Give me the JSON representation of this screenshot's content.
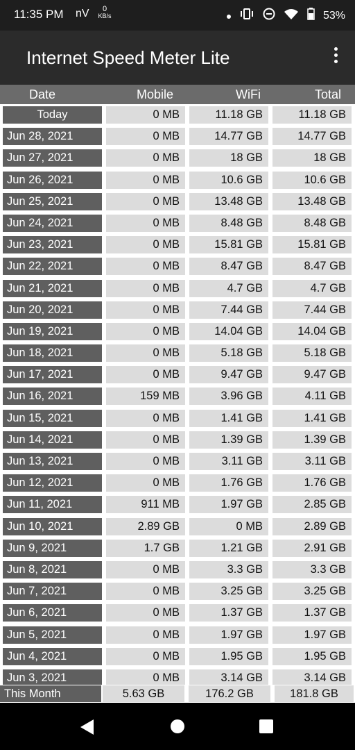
{
  "status": {
    "time": "11:35 PM",
    "nv": "nV",
    "speed_value": "0",
    "speed_unit": "KB/s",
    "battery": "53%"
  },
  "app": {
    "title": "Internet Speed Meter Lite"
  },
  "columns": {
    "date": "Date",
    "mobile": "Mobile",
    "wifi": "WiFi",
    "total": "Total"
  },
  "rows": [
    {
      "date": "Today",
      "mobile": "0 MB",
      "wifi": "11.18 GB",
      "total": "11.18 GB"
    },
    {
      "date": "Jun 28, 2021",
      "mobile": "0 MB",
      "wifi": "14.77 GB",
      "total": "14.77 GB"
    },
    {
      "date": "Jun 27, 2021",
      "mobile": "0 MB",
      "wifi": "18 GB",
      "total": "18 GB"
    },
    {
      "date": "Jun 26, 2021",
      "mobile": "0 MB",
      "wifi": "10.6 GB",
      "total": "10.6 GB"
    },
    {
      "date": "Jun 25, 2021",
      "mobile": "0 MB",
      "wifi": "13.48 GB",
      "total": "13.48 GB"
    },
    {
      "date": "Jun 24, 2021",
      "mobile": "0 MB",
      "wifi": "8.48 GB",
      "total": "8.48 GB"
    },
    {
      "date": "Jun 23, 2021",
      "mobile": "0 MB",
      "wifi": "15.81 GB",
      "total": "15.81 GB"
    },
    {
      "date": "Jun 22, 2021",
      "mobile": "0 MB",
      "wifi": "8.47 GB",
      "total": "8.47 GB"
    },
    {
      "date": "Jun 21, 2021",
      "mobile": "0 MB",
      "wifi": "4.7 GB",
      "total": "4.7 GB"
    },
    {
      "date": "Jun 20, 2021",
      "mobile": "0 MB",
      "wifi": "7.44 GB",
      "total": "7.44 GB"
    },
    {
      "date": "Jun 19, 2021",
      "mobile": "0 MB",
      "wifi": "14.04 GB",
      "total": "14.04 GB"
    },
    {
      "date": "Jun 18, 2021",
      "mobile": "0 MB",
      "wifi": "5.18 GB",
      "total": "5.18 GB"
    },
    {
      "date": "Jun 17, 2021",
      "mobile": "0 MB",
      "wifi": "9.47 GB",
      "total": "9.47 GB"
    },
    {
      "date": "Jun 16, 2021",
      "mobile": "159 MB",
      "wifi": "3.96 GB",
      "total": "4.11 GB"
    },
    {
      "date": "Jun 15, 2021",
      "mobile": "0 MB",
      "wifi": "1.41 GB",
      "total": "1.41 GB"
    },
    {
      "date": "Jun 14, 2021",
      "mobile": "0 MB",
      "wifi": "1.39 GB",
      "total": "1.39 GB"
    },
    {
      "date": "Jun 13, 2021",
      "mobile": "0 MB",
      "wifi": "3.11 GB",
      "total": "3.11 GB"
    },
    {
      "date": "Jun 12, 2021",
      "mobile": "0 MB",
      "wifi": "1.76 GB",
      "total": "1.76 GB"
    },
    {
      "date": "Jun 11, 2021",
      "mobile": "911 MB",
      "wifi": "1.97 GB",
      "total": "2.85 GB"
    },
    {
      "date": "Jun 10, 2021",
      "mobile": "2.89 GB",
      "wifi": "0 MB",
      "total": "2.89 GB"
    },
    {
      "date": "Jun 9, 2021",
      "mobile": "1.7 GB",
      "wifi": "1.21 GB",
      "total": "2.91 GB"
    },
    {
      "date": "Jun 8, 2021",
      "mobile": "0 MB",
      "wifi": "3.3 GB",
      "total": "3.3 GB"
    },
    {
      "date": "Jun 7, 2021",
      "mobile": "0 MB",
      "wifi": "3.25 GB",
      "total": "3.25 GB"
    },
    {
      "date": "Jun 6, 2021",
      "mobile": "0 MB",
      "wifi": "1.37 GB",
      "total": "1.37 GB"
    },
    {
      "date": "Jun 5, 2021",
      "mobile": "0 MB",
      "wifi": "1.97 GB",
      "total": "1.97 GB"
    },
    {
      "date": "Jun 4, 2021",
      "mobile": "0 MB",
      "wifi": "1.95 GB",
      "total": "1.95 GB"
    },
    {
      "date": "Jun 3, 2021",
      "mobile": "0 MB",
      "wifi": "3.14 GB",
      "total": "3.14 GB"
    }
  ],
  "footer": {
    "label": "This Month",
    "mobile": "5.63 GB",
    "wifi": "176.2 GB",
    "total": "181.8 GB"
  },
  "icons": {
    "status": [
      "dot-icon",
      "vibrate-icon",
      "dnd-icon",
      "wifi-icon",
      "battery-icon"
    ],
    "nav": [
      "back-icon",
      "home-icon",
      "recents-icon"
    ]
  }
}
